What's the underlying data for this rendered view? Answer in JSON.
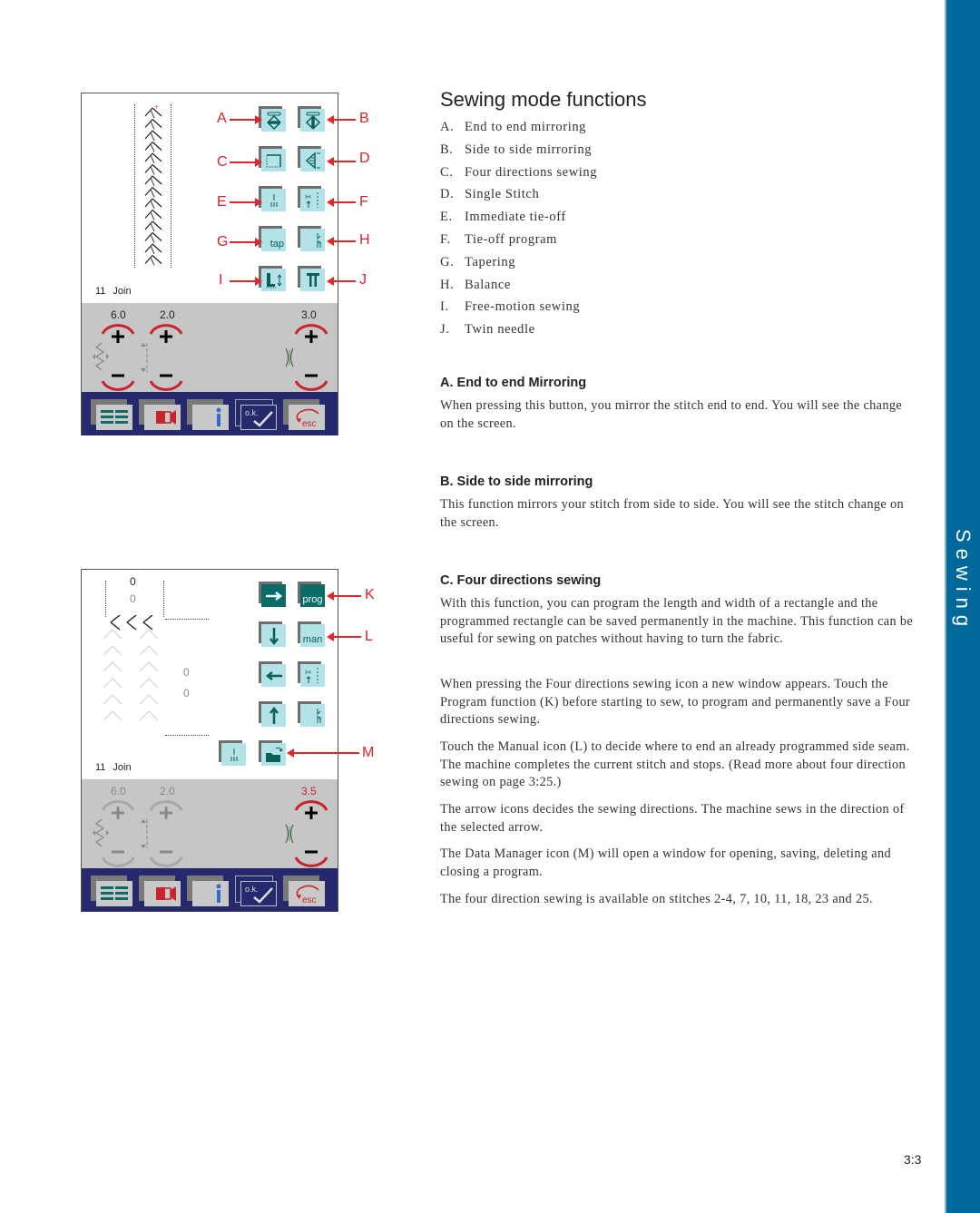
{
  "sidebar": {
    "label": "Sewing",
    "color": "#00689a"
  },
  "page_number": "3:3",
  "title": "Sewing mode functions",
  "functions": [
    {
      "letter": "A.",
      "label": "End to end mirroring"
    },
    {
      "letter": "B.",
      "label": "Side to side mirroring"
    },
    {
      "letter": "C.",
      "label": "Four directions sewing"
    },
    {
      "letter": "D.",
      "label": "Single Stitch"
    },
    {
      "letter": "E.",
      "label": "Immediate tie-off"
    },
    {
      "letter": "F.",
      "label": "Tie-off program"
    },
    {
      "letter": "G.",
      "label": "Tapering"
    },
    {
      "letter": "H.",
      "label": "Balance"
    },
    {
      "letter": "I.",
      "label": "Free-motion sewing"
    },
    {
      "letter": "J.",
      "label": "Twin needle"
    }
  ],
  "sections": [
    {
      "heading": "A. End to end Mirroring",
      "paragraphs": [
        "When pressing this button, you mirror the stitch end to end. You will see the change on the screen."
      ]
    },
    {
      "heading": "B. Side to side mirroring",
      "paragraphs": [
        "This function mirrors your stitch from side to side. You will see the stitch change on the screen."
      ]
    },
    {
      "heading": "C. Four directions sewing",
      "paragraphs": [
        "With this function, you can program the length and width of a rectangle and the programmed rectangle can be saved permanently in the machine. This function can be useful for sewing on patches without having to turn the fabric.",
        "When pressing the Four directions sewing icon a new window appears. Touch the Program function (K) before starting to sew, to program and permanently save a Four directions sewing.",
        "Touch the Manual icon (L) to decide where to end an already programmed side seam. The machine completes the current stitch and stops. (Read more about four direction sewing on page 3:25.)",
        "The arrow icons decides the sewing directions. The machine sews in the direction of the selected arrow.",
        "The Data Manager icon (M) will open a window for opening, saving, deleting and closing a program.",
        "The four direction sewing is available on stitches 2-4, 7, 10, 11, 18, 23 and 25."
      ]
    }
  ],
  "screen1": {
    "stitch_number": "11",
    "stitch_name": "Join",
    "callouts": [
      "A",
      "B",
      "C",
      "D",
      "E",
      "F",
      "G",
      "H",
      "I",
      "J"
    ],
    "button_texts": {
      "tapering": "tap"
    },
    "width_value": "6.0",
    "length_value": "2.0",
    "tension_value": "3.0",
    "bottom_buttons": [
      "stitch-menu",
      "info-exit",
      "info",
      "ok",
      "esc"
    ],
    "ok_label": "o.k.",
    "esc_label": "esc"
  },
  "screen2": {
    "stitch_number": "11",
    "stitch_name": "Join",
    "callouts": [
      "K",
      "L",
      "M"
    ],
    "button_texts": {
      "program": "prog",
      "manual": "man"
    },
    "top_value": "0",
    "top_value_dim": "0",
    "side_value_1": "0",
    "side_value_2": "0",
    "width_value": "6.0",
    "length_value": "2.0",
    "tension_value": "3.5",
    "ok_label": "o.k.",
    "esc_label": "esc"
  }
}
